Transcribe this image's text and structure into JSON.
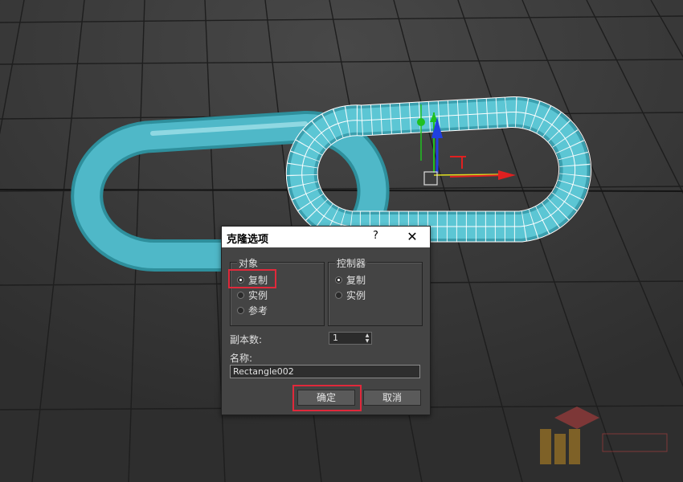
{
  "dialog": {
    "title": "克隆选项",
    "help": "?",
    "close": "✕",
    "object_group": {
      "legend": "对象",
      "options": [
        "复制",
        "实例",
        "参考"
      ],
      "selected": 0
    },
    "controller_group": {
      "legend": "控制器",
      "options": [
        "复制",
        "实例"
      ],
      "selected": 0
    },
    "copies_label": "副本数:",
    "copies_value": "1",
    "name_label": "名称:",
    "name_value": "Rectangle002",
    "ok_label": "确定",
    "cancel_label": "取消"
  },
  "colors": {
    "viewport_bg": "#3a3a3a",
    "chain_color": "#4fb8c8",
    "wire_color": "#ffffff",
    "highlight": "#e0293b",
    "gizmo_x": "#e02020",
    "gizmo_y": "#20c020",
    "gizmo_z": "#2040e0"
  },
  "icons": [
    "move-gizmo-icon",
    "radio-icon",
    "spinner-arrows-icon",
    "close-icon",
    "help-icon",
    "watermark-logo-icon"
  ]
}
